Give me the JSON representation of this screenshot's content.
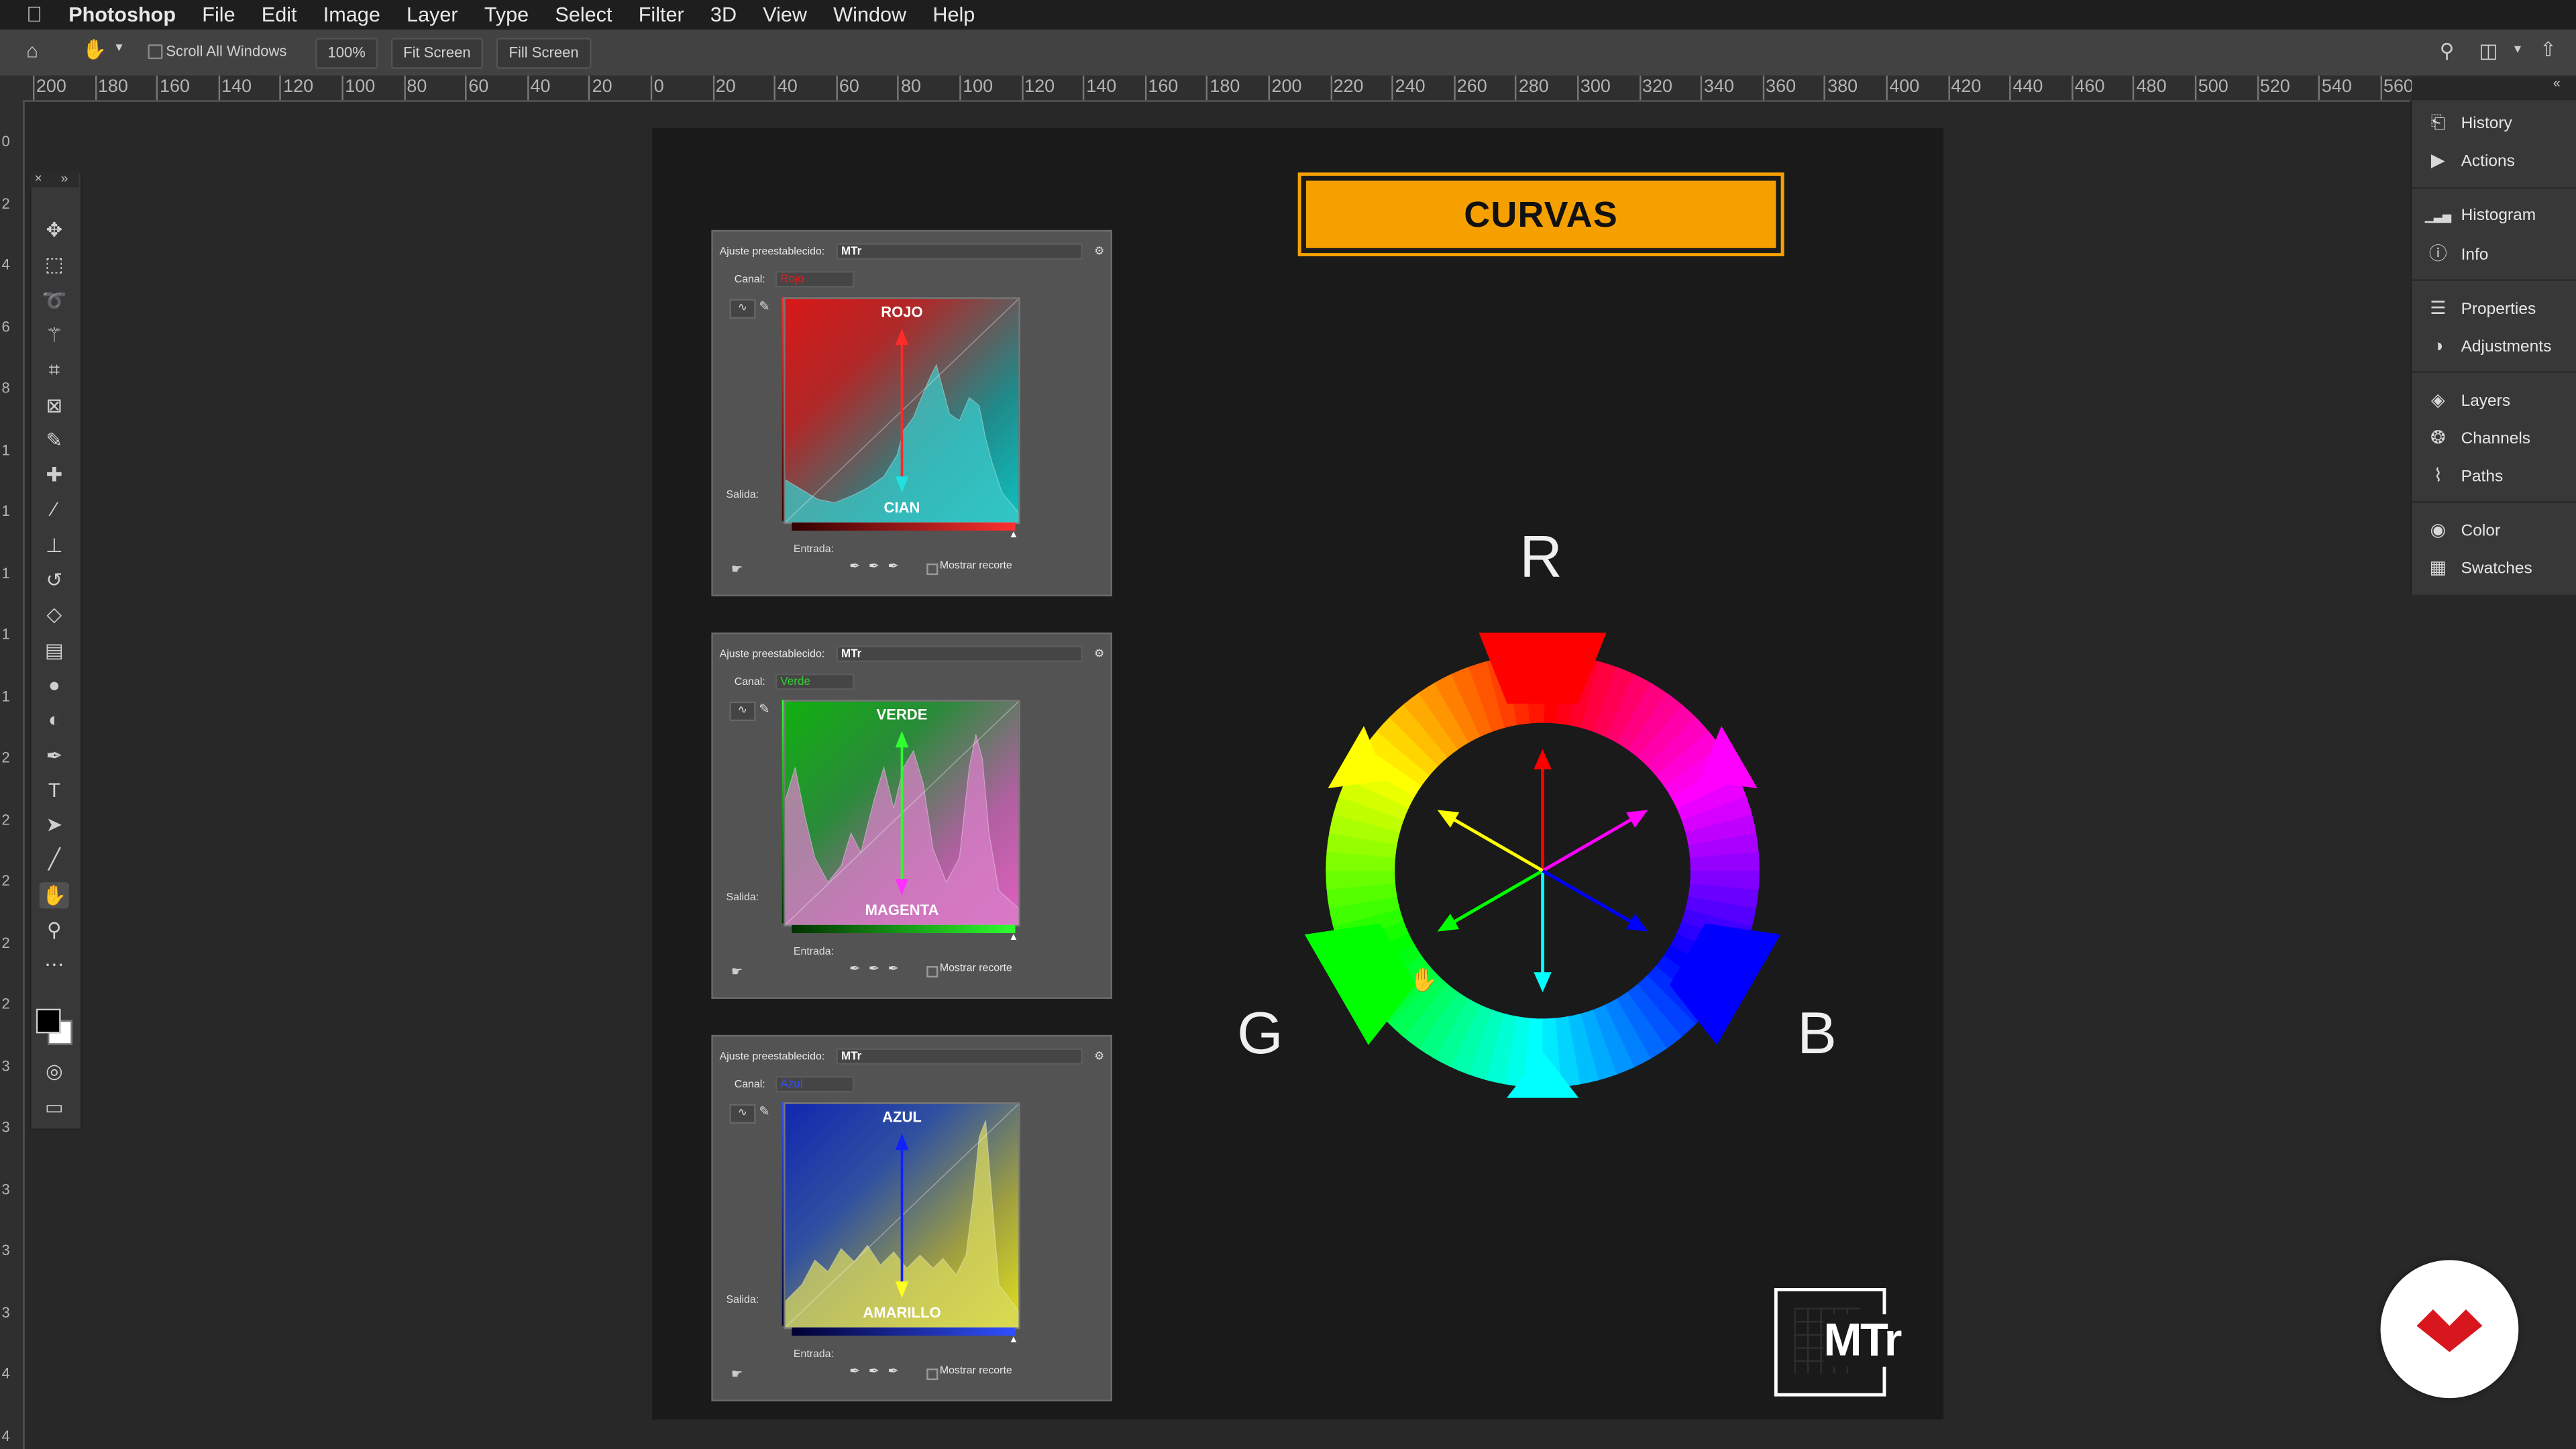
{
  "menubar": {
    "apple": "",
    "app_name": "Photoshop",
    "items": [
      "File",
      "Edit",
      "Image",
      "Layer",
      "Type",
      "Select",
      "Filter",
      "3D",
      "View",
      "Window",
      "Help"
    ]
  },
  "options_bar": {
    "scroll_all_windows": "Scroll All Windows",
    "zoom": "100%",
    "fit_screen": "Fit Screen",
    "fill_screen": "Fill Screen"
  },
  "ruler": {
    "h_labels": [
      "200",
      "180",
      "160",
      "140",
      "120",
      "100",
      "80",
      "60",
      "40",
      "20",
      "0",
      "20",
      "40",
      "60",
      "80",
      "100",
      "120",
      "140",
      "160",
      "180",
      "200",
      "220",
      "240",
      "260",
      "280",
      "300",
      "320",
      "340",
      "360",
      "380",
      "400",
      "420",
      "440",
      "460",
      "480",
      "500",
      "520",
      "540",
      "560"
    ],
    "v_labels": [
      "0",
      "2",
      "4",
      "6",
      "8",
      "1",
      "1",
      "1",
      "1",
      "1",
      "2",
      "2",
      "2",
      "2",
      "2",
      "3",
      "3",
      "3",
      "3",
      "3",
      "4",
      "4"
    ]
  },
  "tools": [
    "move-icon",
    "marquee-icon",
    "lasso-icon",
    "magic-wand-icon",
    "crop-icon",
    "frame-icon",
    "eyedropper-icon",
    "healing-icon",
    "brush-icon",
    "stamp-icon",
    "history-brush-icon",
    "eraser-icon",
    "gradient-icon",
    "blur-icon",
    "dodge-icon",
    "pen-icon",
    "type-icon",
    "path-select-icon",
    "line-icon",
    "hand-icon",
    "zoom-icon",
    "more-icon"
  ],
  "canvas": {
    "title": "CURVAS",
    "wheel_labels": {
      "r": "R",
      "g": "G",
      "b": "B"
    },
    "logo": "MTr"
  },
  "curves_panels": [
    {
      "preset_label": "Ajuste preestablecido:",
      "preset_value": "MTr",
      "canal_label": "Canal:",
      "canal_value": "Rojo",
      "canal_color": "#e02020",
      "top_label": "ROJO",
      "bottom_label": "CIAN",
      "salida": "Salida:",
      "entrada": "Entrada:",
      "mostrar": "Mostrar recorte"
    },
    {
      "preset_label": "Ajuste preestablecido:",
      "preset_value": "MTr",
      "canal_label": "Canal:",
      "canal_value": "Verde",
      "canal_color": "#30d030",
      "top_label": "VERDE",
      "bottom_label": "MAGENTA",
      "salida": "Salida:",
      "entrada": "Entrada:",
      "mostrar": "Mostrar recorte"
    },
    {
      "preset_label": "Ajuste preestablecido:",
      "preset_value": "MTr",
      "canal_label": "Canal:",
      "canal_value": "Azul",
      "canal_color": "#3050ff",
      "top_label": "AZUL",
      "bottom_label": "AMARILLO",
      "salida": "Salida:",
      "entrada": "Entrada:",
      "mostrar": "Mostrar recorte"
    }
  ],
  "right_panel": {
    "items": [
      {
        "label": "History",
        "icon": "history-icon"
      },
      {
        "label": "Actions",
        "icon": "play-icon"
      },
      {
        "label": "Histogram",
        "icon": "histogram-icon"
      },
      {
        "label": "Info",
        "icon": "info-icon"
      },
      {
        "label": "Properties",
        "icon": "properties-icon"
      },
      {
        "label": "Adjustments",
        "icon": "adjustments-icon"
      },
      {
        "label": "Layers",
        "icon": "layers-icon"
      },
      {
        "label": "Channels",
        "icon": "channels-icon"
      },
      {
        "label": "Paths",
        "icon": "paths-icon"
      },
      {
        "label": "Color",
        "icon": "color-icon"
      },
      {
        "label": "Swatches",
        "icon": "swatches-icon"
      }
    ]
  },
  "colors": {
    "accent": "#f6a000",
    "badge_red": "#d8161d"
  }
}
